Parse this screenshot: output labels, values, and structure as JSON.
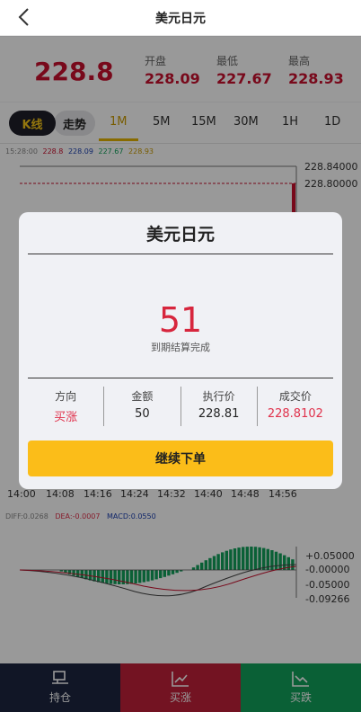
{
  "header": {
    "title": "美元日元"
  },
  "price": {
    "current": "228.8",
    "open_label": "开盘",
    "open": "228.09",
    "low_label": "最低",
    "low": "227.67",
    "high_label": "最高",
    "high": "228.93"
  },
  "tabs": {
    "kline": "K线",
    "trend": "走势",
    "timeframes": [
      "1M",
      "5M",
      "15M",
      "30M",
      "1H",
      "1D"
    ],
    "active_timeframe": "1M"
  },
  "ohlc_line": {
    "time": "15:28:00",
    "close": "228.8",
    "open": "228.09",
    "low": "227.67",
    "high": "228.93"
  },
  "y_labels": [
    "228.84000",
    "228.80000"
  ],
  "x_labels": [
    "14:00",
    "14:08",
    "14:16",
    "14:24",
    "14:32",
    "14:40",
    "14:48",
    "14:56"
  ],
  "macd": {
    "diff": "DIFF:0.0268",
    "dea": "DEA:-0.0007",
    "macd": "MACD:0.0550",
    "axis": [
      "+0.05000",
      "-0.00000",
      "-0.05000",
      "-0.09266"
    ],
    "colors": {
      "diff": "#888888",
      "dea": "#e0314b",
      "macd": "#1a3fb0"
    }
  },
  "modal": {
    "title": "美元日元",
    "countdown": "51",
    "status": "到期结算完成",
    "columns": [
      {
        "label": "方向",
        "value": "买涨",
        "red": true
      },
      {
        "label": "金额",
        "value": "50",
        "red": false
      },
      {
        "label": "执行价",
        "value": "228.81",
        "red": false
      },
      {
        "label": "成交价",
        "value": "228.8102",
        "red": true
      }
    ],
    "button": "继续下单"
  },
  "bottom": {
    "hold": "持仓",
    "buy_up": "买涨",
    "buy_down": "买跌"
  },
  "colors": {
    "up": "#c0203a",
    "down": "#11a05a",
    "accent": "#fbbd19",
    "dark": "#1d2540"
  }
}
